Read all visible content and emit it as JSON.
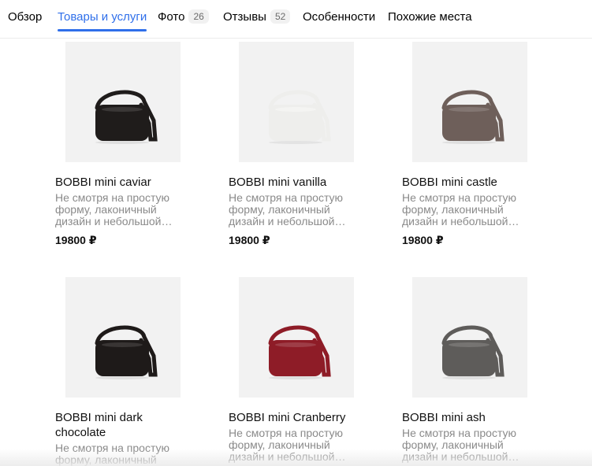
{
  "tabs": [
    {
      "label": "Обзор",
      "count": null,
      "active": false
    },
    {
      "label": "Товары и услуги",
      "count": null,
      "active": true
    },
    {
      "label": "Фото",
      "count": "26",
      "active": false
    },
    {
      "label": "Отзывы",
      "count": "52",
      "active": false
    },
    {
      "label": "Особенности",
      "count": null,
      "active": false
    },
    {
      "label": "Похожие места",
      "count": null,
      "active": false
    }
  ],
  "accent_color": "#2f6fea",
  "products": [
    {
      "title": "BOBBI mini caviar",
      "description": "Не смотря на простую форму, лаконичный дизайн и небольшой…",
      "desc_lines": [
        "Не смотря на простую",
        "форму, лаконичный",
        "дизайн и небольшой…"
      ],
      "price": "19800 ₽",
      "bag_color": "#1f1c1b"
    },
    {
      "title": "BOBBI mini vanilla",
      "description": "Не смотря на простую форму, лаконичный дизайн и небольшой…",
      "desc_lines": [
        "Не смотря на простую",
        "форму, лаконичный",
        "дизайн и небольшой…"
      ],
      "price": "19800 ₽",
      "bag_color": "#eeeeec"
    },
    {
      "title": "BOBBI mini castle",
      "description": "Не смотря на простую форму, лаконичный дизайн и небольшой…",
      "desc_lines": [
        "Не смотря на простую",
        "форму, лаконичный",
        "дизайн и небольшой…"
      ],
      "price": "19800 ₽",
      "bag_color": "#6e5f5a"
    },
    {
      "title": "BOBBI mini dark chocolate",
      "title_lines": [
        "BOBBI mini dark",
        "chocolate"
      ],
      "description": "Не смотря на простую форму, лаконичный дизайн и небольшой…",
      "desc_lines": [
        "Не смотря на простую",
        "форму, лаконичный"
      ],
      "price": "",
      "bag_color": "#1e1a19"
    },
    {
      "title": "BOBBI mini Cranberry",
      "description": "Не смотря на простую форму, лаконичный дизайн и небольшой…",
      "desc_lines": [
        "Не смотря на простую",
        "форму, лаконичный",
        "дизайн и небольшой…"
      ],
      "price": "",
      "bag_color": "#8e1c27"
    },
    {
      "title": "BOBBI mini ash",
      "description": "Не смотря на простую форму, лаконичный дизайн и небольшой…",
      "desc_lines": [
        "Не смотря на простую",
        "форму, лаконичный",
        "дизайн и небольшой…"
      ],
      "price": "",
      "bag_color": "#5e5c5a"
    }
  ]
}
